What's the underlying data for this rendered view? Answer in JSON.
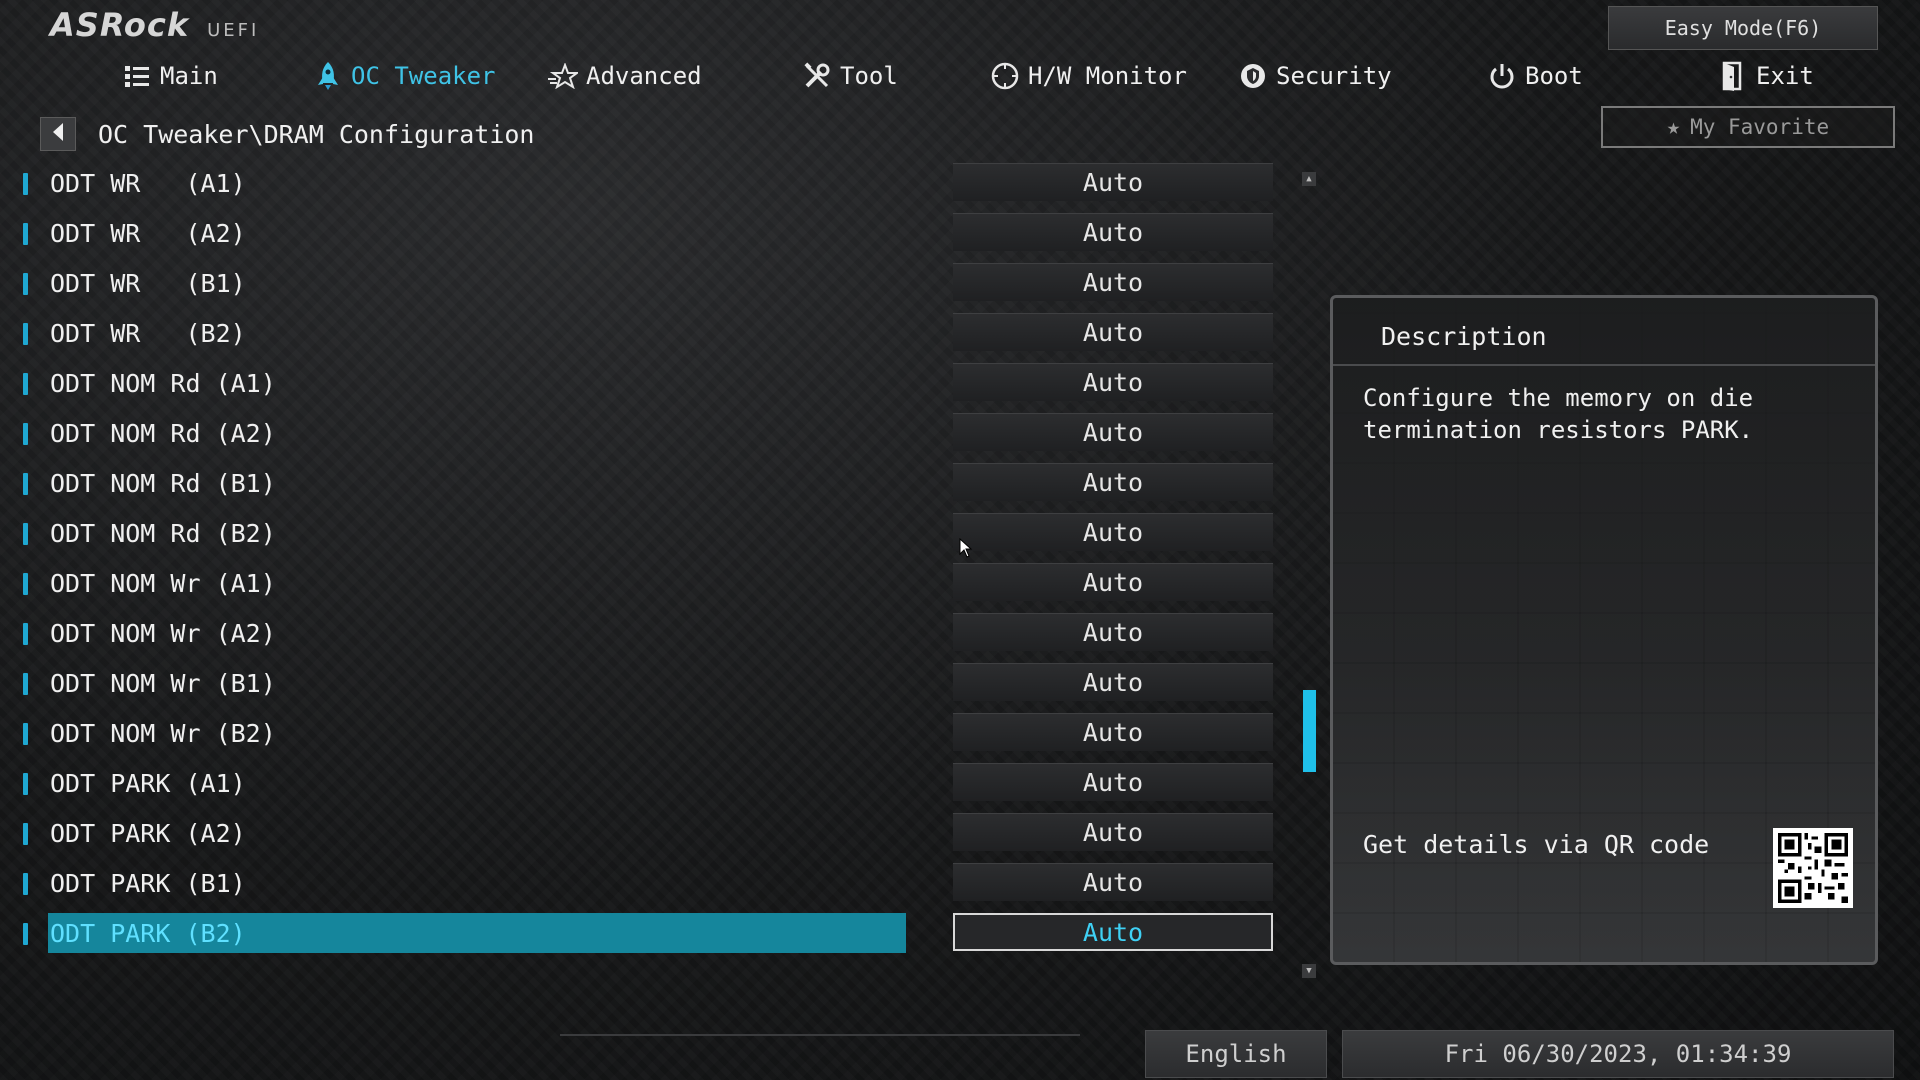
{
  "header": {
    "brand": "ASRock",
    "product": "UEFI",
    "easy_mode_label": "Easy Mode(F6)"
  },
  "nav": {
    "active": "oc_tweaker",
    "items": [
      {
        "id": "main",
        "label": "Main",
        "icon": "list-icon"
      },
      {
        "id": "oc_tweaker",
        "label": "OC Tweaker",
        "icon": "rocket-icon"
      },
      {
        "id": "advanced",
        "label": "Advanced",
        "icon": "star-icon"
      },
      {
        "id": "tool",
        "label": "Tool",
        "icon": "tools-icon"
      },
      {
        "id": "hw_monitor",
        "label": "H/W Monitor",
        "icon": "monitor-gauge-icon"
      },
      {
        "id": "security",
        "label": "Security",
        "icon": "shield-icon"
      },
      {
        "id": "boot",
        "label": "Boot",
        "icon": "power-icon"
      },
      {
        "id": "exit",
        "label": "Exit",
        "icon": "exit-door-icon"
      }
    ]
  },
  "breadcrumb": {
    "path": "OC Tweaker\\DRAM Configuration"
  },
  "favorite": {
    "label": "My Favorite"
  },
  "settings": {
    "selected_index": 15,
    "items": [
      {
        "label": "ODT WR   (A1)",
        "value": "Auto"
      },
      {
        "label": "ODT WR   (A2)",
        "value": "Auto"
      },
      {
        "label": "ODT WR   (B1)",
        "value": "Auto"
      },
      {
        "label": "ODT WR   (B2)",
        "value": "Auto"
      },
      {
        "label": "ODT NOM Rd (A1)",
        "value": "Auto"
      },
      {
        "label": "ODT NOM Rd (A2)",
        "value": "Auto"
      },
      {
        "label": "ODT NOM Rd (B1)",
        "value": "Auto"
      },
      {
        "label": "ODT NOM Rd (B2)",
        "value": "Auto"
      },
      {
        "label": "ODT NOM Wr (A1)",
        "value": "Auto"
      },
      {
        "label": "ODT NOM Wr (A2)",
        "value": "Auto"
      },
      {
        "label": "ODT NOM Wr (B1)",
        "value": "Auto"
      },
      {
        "label": "ODT NOM Wr (B2)",
        "value": "Auto"
      },
      {
        "label": "ODT PARK (A1)",
        "value": "Auto"
      },
      {
        "label": "ODT PARK (A2)",
        "value": "Auto"
      },
      {
        "label": "ODT PARK (B1)",
        "value": "Auto"
      },
      {
        "label": "ODT PARK (B2)",
        "value": "Auto"
      }
    ]
  },
  "description": {
    "title": "Description",
    "body": "Configure the memory on die termination resistors PARK.",
    "qr_label": "Get details via QR code"
  },
  "footer": {
    "language": "English",
    "datetime": "Fri 06/30/2023, 01:34:39"
  },
  "colors": {
    "accent": "#3fc3e6",
    "selected_row": "#15869c",
    "scroll_thumb": "#1fc0ea"
  }
}
